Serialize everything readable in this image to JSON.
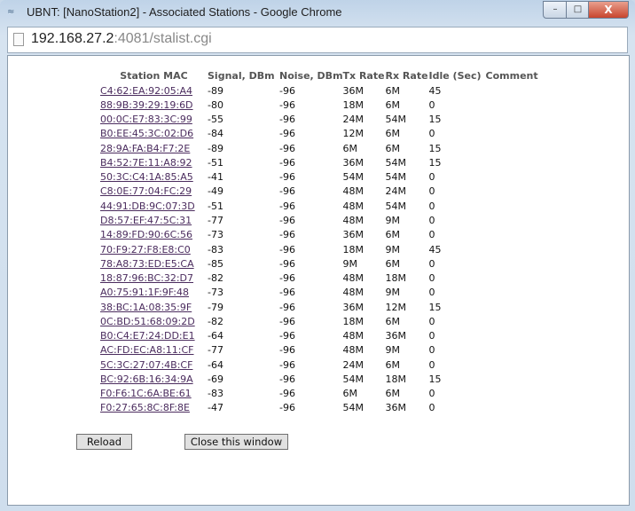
{
  "window": {
    "title": "UBNT: [NanoStation2] - Associated Stations - Google Chrome",
    "minimize": "–",
    "maximize": "□",
    "close": "X"
  },
  "address": {
    "host": "192.168.27.2",
    "rest": ":4081/stalist.cgi"
  },
  "table": {
    "headers": [
      "Station MAC",
      "Signal, DBm",
      "Noise, DBm",
      "Tx Rate",
      "Rx Rate",
      "Idle (Sec)",
      "Comment"
    ],
    "rows": [
      [
        "C4:62:EA:92:05:A4",
        "-89",
        "-96",
        "36M",
        "6M",
        "45",
        ""
      ],
      [
        "88:9B:39:29:19:6D",
        "-80",
        "-96",
        "18M",
        "6M",
        "0",
        ""
      ],
      [
        "00:0C:E7:83:3C:99",
        "-55",
        "-96",
        "24M",
        "54M",
        "15",
        ""
      ],
      [
        "B0:EE:45:3C:02:D6",
        "-84",
        "-96",
        "12M",
        "6M",
        "0",
        ""
      ],
      [
        "28:9A:FA:B4:F7:2E",
        "-89",
        "-96",
        "6M",
        "6M",
        "15",
        ""
      ],
      [
        "B4:52:7E:11:A8:92",
        "-51",
        "-96",
        "36M",
        "54M",
        "15",
        ""
      ],
      [
        "50:3C:C4:1A:85:A5",
        "-41",
        "-96",
        "54M",
        "54M",
        "0",
        ""
      ],
      [
        "C8:0E:77:04:FC:29",
        "-49",
        "-96",
        "48M",
        "24M",
        "0",
        ""
      ],
      [
        "44:91:DB:9C:07:3D",
        "-51",
        "-96",
        "48M",
        "54M",
        "0",
        ""
      ],
      [
        "D8:57:EF:47:5C:31",
        "-77",
        "-96",
        "48M",
        "9M",
        "0",
        ""
      ],
      [
        "14:89:FD:90:6C:56",
        "-73",
        "-96",
        "36M",
        "6M",
        "0",
        ""
      ],
      [
        "70:F9:27:F8:E8:C0",
        "-83",
        "-96",
        "18M",
        "9M",
        "45",
        ""
      ],
      [
        "78:A8:73:ED:E5:CA",
        "-85",
        "-96",
        "9M",
        "6M",
        "0",
        ""
      ],
      [
        "18:87:96:BC:32:D7",
        "-82",
        "-96",
        "48M",
        "18M",
        "0",
        ""
      ],
      [
        "A0:75:91:1F:9F:48",
        "-73",
        "-96",
        "48M",
        "9M",
        "0",
        ""
      ],
      [
        "38:BC:1A:08:35:9F",
        "-79",
        "-96",
        "36M",
        "12M",
        "15",
        ""
      ],
      [
        "0C:BD:51:68:09:2D",
        "-82",
        "-96",
        "18M",
        "6M",
        "0",
        ""
      ],
      [
        "B0:C4:E7:24:DD:E1",
        "-64",
        "-96",
        "48M",
        "36M",
        "0",
        ""
      ],
      [
        "AC:FD:EC:A8:11:CF",
        "-77",
        "-96",
        "48M",
        "9M",
        "0",
        ""
      ],
      [
        "5C:3C:27:07:4B:CF",
        "-64",
        "-96",
        "24M",
        "6M",
        "0",
        ""
      ],
      [
        "BC:92:6B:16:34:9A",
        "-69",
        "-96",
        "54M",
        "18M",
        "15",
        ""
      ],
      [
        "F0:F6:1C:6A:BE:61",
        "-83",
        "-96",
        "6M",
        "6M",
        "0",
        ""
      ],
      [
        "F0:27:65:8C:8F:8E",
        "-47",
        "-96",
        "54M",
        "36M",
        "0",
        ""
      ]
    ]
  },
  "buttons": {
    "reload": "Reload",
    "close": "Close this window"
  }
}
